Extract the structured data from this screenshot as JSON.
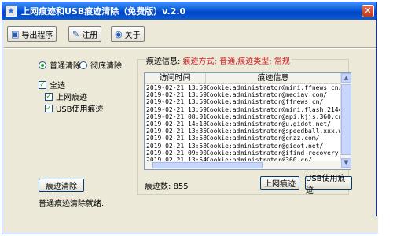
{
  "window": {
    "title": "上网痕迹和USB痕迹清除（免费版）v.2.0",
    "close_glyph": "✕",
    "app_icon_glyph": "★"
  },
  "toolbar": {
    "export": {
      "label": "导出程序",
      "icon": "export-icon",
      "glyph": "▣"
    },
    "register": {
      "label": "注册",
      "icon": "register-icon",
      "glyph": "✎"
    },
    "about": {
      "label": "关于",
      "icon": "about-icon",
      "glyph": "◉"
    }
  },
  "mode": {
    "normal_label": "普通清除",
    "thorough_label": "彻底清除",
    "selected": "normal"
  },
  "options": {
    "select_all": "全选",
    "web_traces": "上网痕迹",
    "usb_traces": "USB使用痕迹",
    "check_glyph": "✓"
  },
  "actions": {
    "clean_button": "痕迹清除",
    "web_button": "上网痕迹",
    "usb_button": "USB使用痕迹"
  },
  "status": {
    "message": "普通痕迹清除就绪."
  },
  "trace_group": {
    "label_prefix": "痕迹信息:",
    "label_detail": "痕迹方式: 普通,痕迹类型: 常规"
  },
  "table": {
    "columns": [
      "访问时间",
      "痕迹信息"
    ],
    "rows": [
      {
        "time": "2019-02-21 13:59:10",
        "info": "Cookie:administrator@mini.ffnews.cn/"
      },
      {
        "time": "2019-02-21 13:59:14",
        "info": "Cookie:administrator@mediav.com/"
      },
      {
        "time": "2019-02-21 13:59:14",
        "info": "Cookie:administrator@ffnews.cn/"
      },
      {
        "time": "2019-02-21 13:59:14",
        "info": "Cookie:administrator@mini.flash.2144.com/"
      },
      {
        "time": "2019-02-21 08:01:42",
        "info": "Cookie:administrator@api.kjjs.360.cn/"
      },
      {
        "time": "2019-02-21 14:18:52",
        "info": "Cookie:administrator@u.gidot.net/"
      },
      {
        "time": "2019-02-21 13:35:29",
        "info": "Cookie:administrator@speedball.xxx.wan.36..."
      },
      {
        "time": "2019-02-21 13:58:50",
        "info": "Cookie:administrator@cnzz.com/"
      },
      {
        "time": "2019-02-21 13:58:50",
        "info": "Cookie:administrator@gidot.net/"
      },
      {
        "time": "2019-02-21 09:00:50",
        "info": "Cookie:administrator@ifind-recovery.com/"
      },
      {
        "time": "2019-02-21 13:54:10",
        "info": "Cookie:administrator@360.cn/"
      },
      {
        "time": "2019-02-21 08:01:24",
        "info": "Cookie:administrator@biddings.com/"
      },
      {
        "time": "2019-02-21 15:26:44",
        "info": "Cookie:administrator@..."
      }
    ]
  },
  "count": {
    "label": "痕迹数:",
    "value": "855"
  },
  "scrollbar": {
    "up": "▲",
    "down": "▼"
  }
}
